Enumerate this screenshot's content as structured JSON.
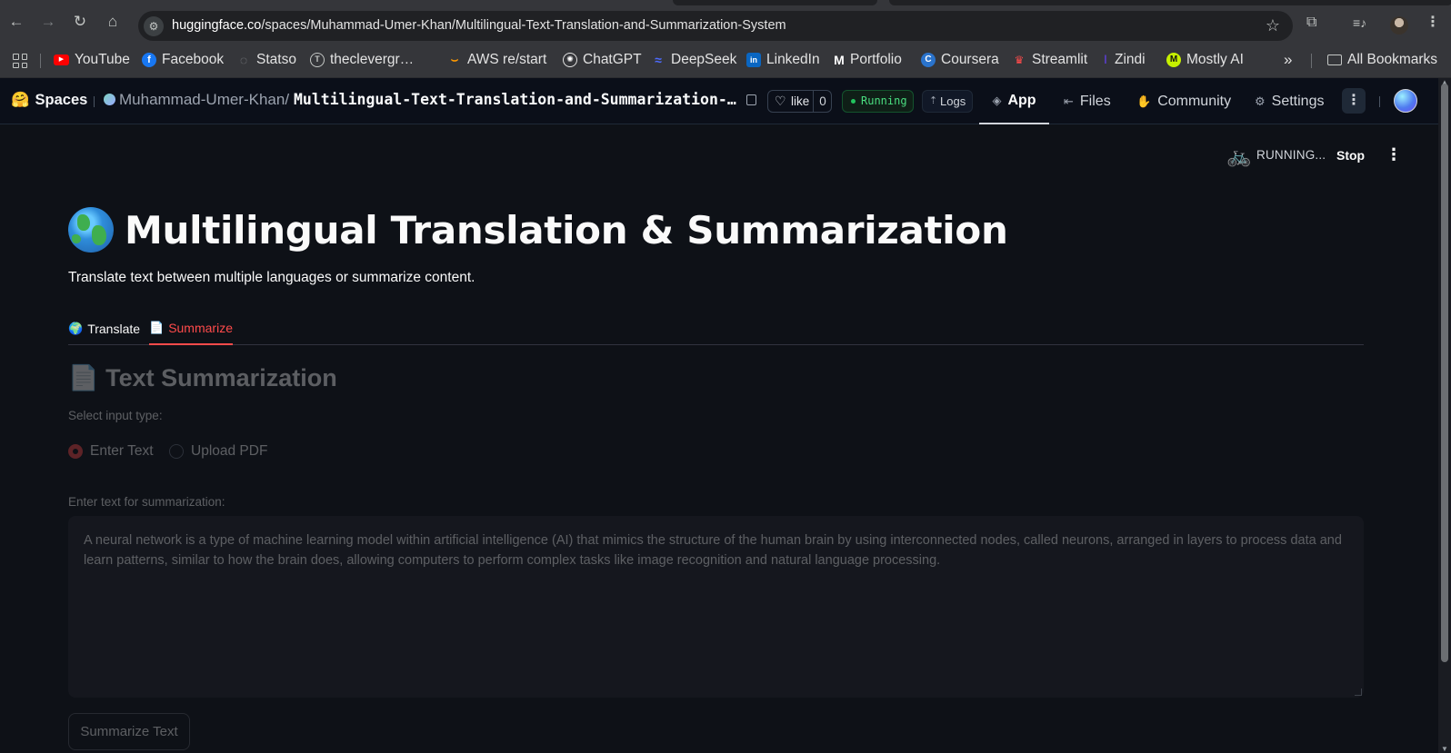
{
  "browser": {
    "url_host": "huggingface.co",
    "url_path": "/spaces/Muhammad-Umer-Khan/Multilingual-Text-Translation-and-Summarization-System",
    "bookmarks": [
      {
        "label": "YouTube",
        "icon": "youtube-icon",
        "color": "#ff0000"
      },
      {
        "label": "Facebook",
        "icon": "facebook-icon",
        "color": "#1877f2"
      },
      {
        "label": "Statso",
        "icon": "statso-icon",
        "color": "#8a8d91"
      },
      {
        "label": "theclevergr…",
        "icon": "theclever-icon",
        "color": "#8a8d91"
      },
      {
        "label": "AWS re/start",
        "icon": "aws-icon",
        "color": "#ff9900"
      },
      {
        "label": "ChatGPT",
        "icon": "chatgpt-icon",
        "color": "#e3e3e3"
      },
      {
        "label": "DeepSeek",
        "icon": "deepseek-icon",
        "color": "#4d6bfe"
      },
      {
        "label": "LinkedIn",
        "icon": "linkedin-icon",
        "color": "#0a66c2"
      },
      {
        "label": "Portfolio",
        "icon": "portfolio-icon",
        "color": "#e3e3e3"
      },
      {
        "label": "Coursera",
        "icon": "coursera-icon",
        "color": "#2a73cc"
      },
      {
        "label": "Streamlit",
        "icon": "streamlit-icon",
        "color": "#ff4b4b"
      },
      {
        "label": "Zindi",
        "icon": "zindi-icon",
        "color": "#5b3fd0"
      },
      {
        "label": "Mostly AI",
        "icon": "mostlyai-icon",
        "color": "#c6f000"
      }
    ],
    "all_bookmarks": "All Bookmarks"
  },
  "hf": {
    "spaces_label": "Spaces",
    "owner": "Muhammad-Umer-Khan/",
    "repo": "Multilingual-Text-Translation-and-Summarization-System",
    "like_label": "like",
    "like_count": "0",
    "status": "Running",
    "logs": "Logs",
    "tabs": [
      {
        "label": "App",
        "icon": "cube-icon",
        "active": true
      },
      {
        "label": "Files",
        "icon": "files-icon",
        "active": false
      },
      {
        "label": "Community",
        "icon": "community-icon",
        "active": false
      },
      {
        "label": "Settings",
        "icon": "gear-icon",
        "active": false
      }
    ]
  },
  "app": {
    "status": "RUNNING...",
    "stop": "Stop",
    "title": "Multilingual Translation & Summarization",
    "subtitle": "Translate text between multiple languages or summarize content.",
    "tabs": [
      {
        "emoji": "🌍",
        "label": "Translate",
        "active": false
      },
      {
        "emoji": "📄",
        "label": "Summarize",
        "active": true
      }
    ],
    "section_emoji": "📄",
    "section_title": "Text Summarization",
    "input_type_label": "Select input type:",
    "options": [
      {
        "label": "Enter Text",
        "selected": true
      },
      {
        "label": "Upload PDF",
        "selected": false
      }
    ],
    "textarea_label": "Enter text for summarization:",
    "textarea_value": "A neural network is a type of machine learning model within artificial intelligence (AI) that mimics the structure of the human brain by using interconnected nodes, called neurons, arranged in layers to process data and learn patterns, similar to how the brain does, allowing computers to perform complex tasks like image recognition and natural language processing.",
    "button": "Summarize Text"
  },
  "colors": {
    "accent": "#ff4b4b",
    "background": "#0e1117",
    "running": "#4ade80"
  }
}
